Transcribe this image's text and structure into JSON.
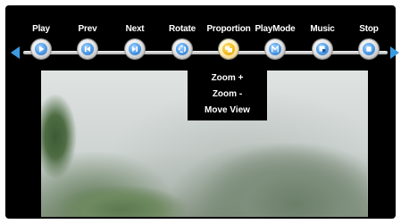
{
  "toolbar": {
    "buttons": [
      {
        "label": "Play",
        "icon": "play-icon"
      },
      {
        "label": "Prev",
        "icon": "prev-icon"
      },
      {
        "label": "Next",
        "icon": "next-icon"
      },
      {
        "label": "Rotate",
        "icon": "rotate-icon"
      },
      {
        "label": "Proportion",
        "icon": "proportion-icon"
      },
      {
        "label": "PlayMode",
        "icon": "playmode-icon"
      },
      {
        "label": "Music",
        "icon": "music-icon"
      },
      {
        "label": "Stop",
        "icon": "stop-icon"
      }
    ],
    "active": "Proportion",
    "accent_color": "#3b9be0",
    "active_color": "#f2b81f"
  },
  "proportion_menu": {
    "items": [
      "Zoom +",
      "Zoom -",
      "Move View"
    ]
  }
}
